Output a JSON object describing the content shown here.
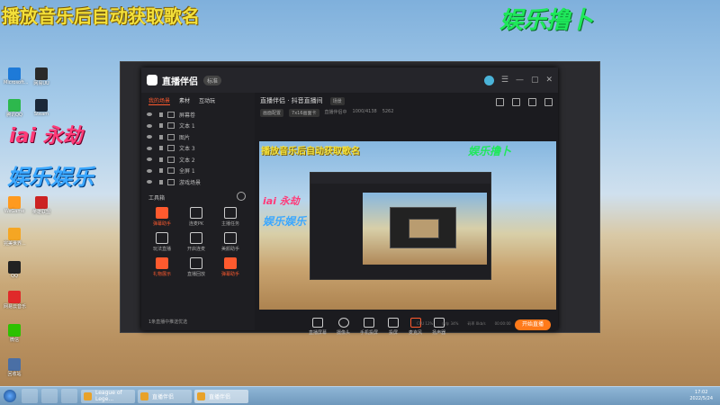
{
  "overlay": {
    "title": "播放音乐后自动获取歌名",
    "watermark_top": "娱乐撸卜",
    "watermark_signature": "iai 永劫",
    "watermark_blue": "娱乐娱乐"
  },
  "desktop_icons": [
    {
      "label": "Microsoft..."
    },
    {
      "label": "网易UU"
    },
    {
      "label": "腾讯QQ"
    },
    {
      "label": "Steam"
    },
    {
      "label": "WeGame"
    },
    {
      "label": "英雄联盟"
    },
    {
      "label": "完美世界..."
    },
    {
      "label": "Counter-Strike..."
    },
    {
      "label": "腾讯手游..."
    },
    {
      "label": "QQ"
    },
    {
      "label": "网易云音乐"
    },
    {
      "label": "微信"
    },
    {
      "label": "回收站"
    }
  ],
  "app": {
    "name": "直播伴侣",
    "version_badge": "标准",
    "sidebar_tabs": [
      "我的场景",
      "素材",
      "互动玩"
    ],
    "layers": [
      "屏幕卷",
      "文本 1",
      "图片",
      "文本 3",
      "文本 2",
      "全屏 1",
      "游戏场景"
    ],
    "tools_title": "工具箱",
    "tools": [
      {
        "label": "弹幕助手",
        "accent": true
      },
      {
        "label": "连麦PK",
        "accent": false
      },
      {
        "label": "主播任务",
        "accent": false
      },
      {
        "label": "玩法直播",
        "accent": false
      },
      {
        "label": "开启连麦",
        "accent": false
      },
      {
        "label": "美颜助手",
        "accent": false
      },
      {
        "label": "礼物展示",
        "accent": true
      },
      {
        "label": "直播回放",
        "accent": false
      },
      {
        "label": "弹幕助手",
        "accent": true
      }
    ],
    "side_footer": "1条直播中推送优选",
    "scene_title": "直播伴侣 · 抖音直播间",
    "scene_chip": "场景",
    "scene_info": [
      "画面配置",
      "7x16画面卡",
      "直播伴侣中"
    ],
    "scene_stats": [
      "1000/4138",
      "5262"
    ],
    "bottom_buttons": [
      "直播屏幕",
      "摄像头",
      "手机投屏",
      "投屏",
      "麦克风",
      "扬声器"
    ],
    "go_live": "开始直播",
    "footer_stats": [
      "CPU 12%",
      "内存 34%",
      "码率 0kb/s",
      "00:00:00"
    ]
  },
  "taskbar": {
    "tasks": [
      "League of Lege...",
      "直播伴侣",
      "直播伴侣"
    ],
    "clock_time": "17:02",
    "clock_date": "2022/5/24"
  },
  "colors": {
    "accent": "#ff5a2e",
    "go_live": "#ff7a1a",
    "watermark_green": "#1fe85a",
    "title_yellow": "#f3e03a"
  }
}
